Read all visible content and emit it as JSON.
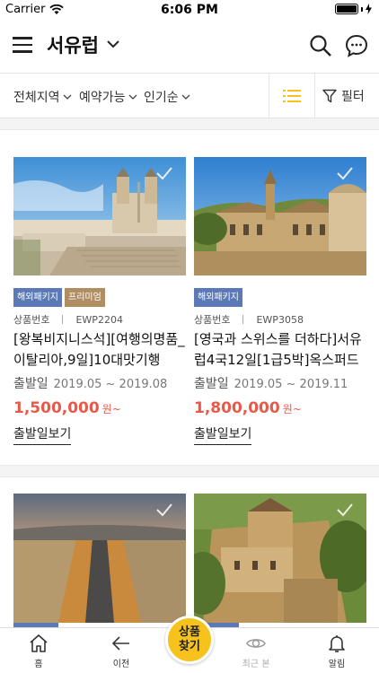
{
  "status_bar": {
    "carrier": "Carrier",
    "time": "6:06 PM"
  },
  "header": {
    "title": "서유럽"
  },
  "filters": {
    "items": [
      "전체지역",
      "예약가능",
      "인기순"
    ],
    "filter_label": "필터",
    "accent_color": "#f6c21b"
  },
  "products": [
    {
      "tags": [
        "해외패키지",
        "프리미엄"
      ],
      "code_label": "상품번호",
      "code": "EWP2204",
      "title": "[왕복비지니스석][여행의명품_이탈리아,9일]10대맛기행",
      "date_label": "출발일",
      "date_range": "2019.05 ~ 2019.08",
      "price": "1,500,000",
      "price_unit": "원~",
      "link_label": "출발일보기"
    },
    {
      "tags": [
        "해외패키지"
      ],
      "code_label": "상품번호",
      "code": "EWP3058",
      "title": "[영국과 스위스를 더하다]서유럽4국12일[1급5박]옥스퍼드",
      "date_label": "출발일",
      "date_range": "2019.05 ~ 2019.11",
      "price": "1,800,000",
      "price_unit": "원~",
      "link_label": "출발일보기"
    }
  ],
  "tab_bar": {
    "home": "홈",
    "back": "이전",
    "find": "상품\n찾기",
    "find_line1": "상품",
    "find_line2": "찾기",
    "recent": "최근 본",
    "alerts": "알림"
  }
}
